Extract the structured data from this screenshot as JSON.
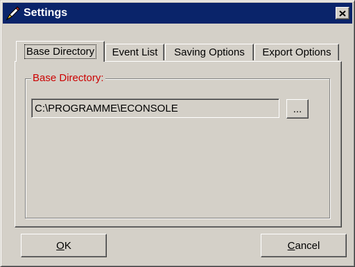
{
  "window": {
    "title": "Settings",
    "titlebar_color": "#0a246a",
    "close_icon": "close-icon",
    "app_icon": "pen-icon"
  },
  "tabs": [
    {
      "label": "Base Directory",
      "active": true
    },
    {
      "label": "Event List",
      "active": false
    },
    {
      "label": "Saving Options",
      "active": false
    },
    {
      "label": "Export Options",
      "active": false
    }
  ],
  "group": {
    "label": "Base Directory:",
    "label_color": "#cc0000",
    "directory_value": "C:\\PROGRAMME\\ECONSOLE",
    "browse_label": "..."
  },
  "buttons": {
    "ok_mnemonic": "O",
    "ok_rest": "K",
    "cancel_mnemonic": "C",
    "cancel_rest": "ancel"
  }
}
